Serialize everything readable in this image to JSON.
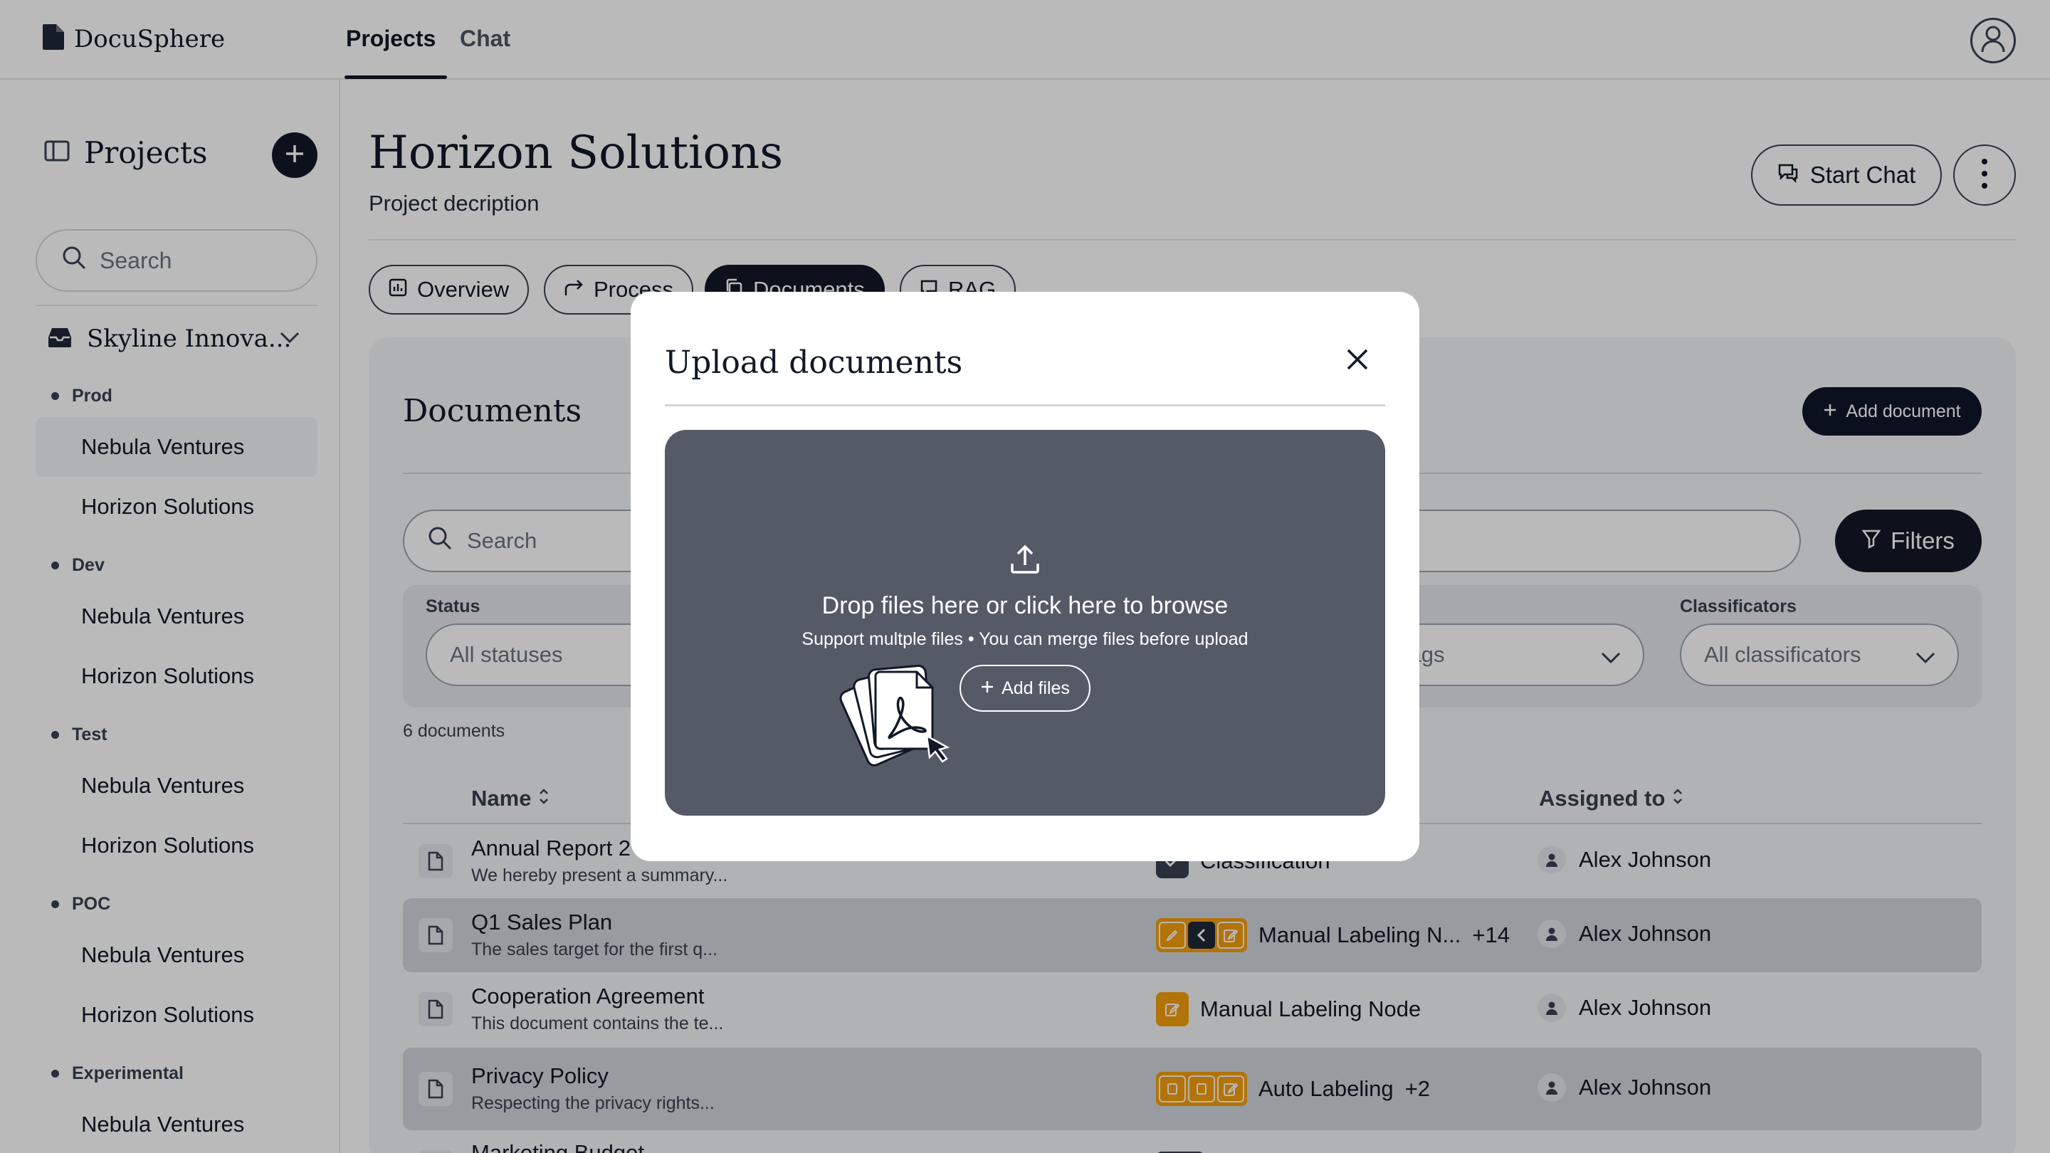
{
  "app": {
    "name": "DocuSphere"
  },
  "nav": {
    "tabs": [
      {
        "label": "Projects",
        "active": true
      },
      {
        "label": "Chat",
        "active": false
      }
    ]
  },
  "sidebar": {
    "title": "Projects",
    "search_placeholder": "Search",
    "org": "Skyline Innova...",
    "envs": [
      {
        "label": "Prod",
        "items": [
          "Nebula Ventures",
          "Horizon Solutions"
        ]
      },
      {
        "label": "Dev",
        "items": [
          "Nebula Ventures",
          "Horizon Solutions"
        ]
      },
      {
        "label": "Test",
        "items": [
          "Nebula Ventures",
          "Horizon Solutions"
        ]
      },
      {
        "label": "POC",
        "items": [
          "Nebula Ventures",
          "Horizon Solutions"
        ]
      },
      {
        "label": "Experimental",
        "items": [
          "Nebula Ventures"
        ]
      }
    ]
  },
  "project": {
    "title": "Horizon Solutions",
    "description": "Project decription",
    "start_chat_label": "Start Chat",
    "tabs": [
      {
        "label": "Overview",
        "icon": "chart-icon"
      },
      {
        "label": "Process",
        "icon": "share-arrow-icon"
      },
      {
        "label": "Documents",
        "icon": "copy-icon",
        "active": true
      },
      {
        "label": "RAG",
        "icon": "chat-bubble-icon"
      }
    ]
  },
  "documents": {
    "title": "Documents",
    "add_label": "Add document",
    "search_placeholder": "Search",
    "filters_label": "Filters",
    "filters": {
      "status_label": "Status",
      "status_value": "All statuses",
      "tags_value": "Tags",
      "classificators_label": "Classificators",
      "classificators_value": "All classificators"
    },
    "count": "6 documents",
    "columns": {
      "name": "Name",
      "assigned": "Assigned to"
    },
    "rows": [
      {
        "name": "Annual Report 2",
        "desc": "We hereby present a summary...",
        "process": "Classification",
        "more": "",
        "assignee": "Alex Johnson"
      },
      {
        "name": "Q1 Sales Plan",
        "desc": "The sales target for the first q...",
        "process": "Manual Labeling N...",
        "more": "+14",
        "assignee": "Alex Johnson"
      },
      {
        "name": "Cooperation Agreement",
        "desc": "This document contains the te...",
        "process": "Manual Labeling Node",
        "more": "",
        "assignee": "Alex Johnson"
      },
      {
        "name": "Privacy Policy",
        "desc": "Respecting the privacy rights...",
        "process": "Auto Labeling",
        "more": "+2",
        "assignee": "Alex Johnson"
      },
      {
        "name": "Marketing Budget",
        "desc": "",
        "process": "",
        "more": "",
        "assignee": ""
      }
    ]
  },
  "modal": {
    "title": "Upload documents",
    "drop_title": "Drop files here or click here to browse",
    "drop_subtitle": "Support multple files • You can merge files before upload",
    "add_files_label": "Add files"
  },
  "colors": {
    "accent": "#111827",
    "process_orange": "#f59e0b",
    "dropzone": "#555a67"
  }
}
